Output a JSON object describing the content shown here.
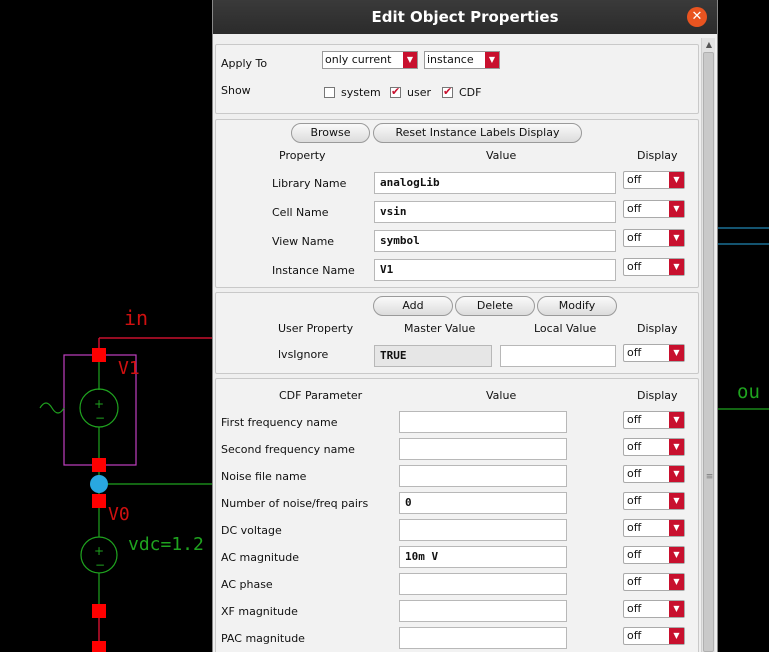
{
  "schematic": {
    "net_in": "in",
    "net_out": "ou",
    "v1_label": "V1",
    "v0_label": "V0",
    "vdc_label": "vdc=1.2"
  },
  "dialog": {
    "title": "Edit Object Properties",
    "close_glyph": "✕",
    "apply_to_label": "Apply To",
    "apply_to_value": "only current",
    "apply_to_type": "instance",
    "show_label": "Show",
    "show_options": [
      {
        "label": "system",
        "checked": false
      },
      {
        "label": "user",
        "checked": true
      },
      {
        "label": "CDF",
        "checked": true
      }
    ],
    "browse_button": "Browse",
    "reset_button": "Reset Instance Labels Display",
    "headers": {
      "property": "Property",
      "value": "Value",
      "display": "Display"
    },
    "properties": [
      {
        "label": "Library Name",
        "value": "analogLib",
        "display": "off"
      },
      {
        "label": "Cell Name",
        "value": "vsin",
        "display": "off"
      },
      {
        "label": "View Name",
        "value": "symbol",
        "display": "off"
      },
      {
        "label": "Instance Name",
        "value": "V1",
        "display": "off"
      }
    ],
    "add_button": "Add",
    "delete_button": "Delete",
    "modify_button": "Modify",
    "user_headers": {
      "user_property": "User Property",
      "master_value": "Master Value",
      "local_value": "Local Value",
      "display": "Display"
    },
    "user_properties": [
      {
        "label": "lvsIgnore",
        "master": "TRUE",
        "local": "",
        "display": "off"
      }
    ],
    "cdf_headers": {
      "param": "CDF Parameter",
      "value": "Value",
      "display": "Display"
    },
    "cdf_params": [
      {
        "label": "First frequency name",
        "value": "",
        "display": "off"
      },
      {
        "label": "Second frequency name",
        "value": "",
        "display": "off"
      },
      {
        "label": "Noise file name",
        "value": "",
        "display": "off"
      },
      {
        "label": "Number of noise/freq pairs",
        "value": "0",
        "display": "off"
      },
      {
        "label": "DC voltage",
        "value": "",
        "display": "off"
      },
      {
        "label": "AC magnitude",
        "value": "10m V",
        "display": "off"
      },
      {
        "label": "AC phase",
        "value": "",
        "display": "off"
      },
      {
        "label": "XF magnitude",
        "value": "",
        "display": "off"
      },
      {
        "label": "PAC magnitude",
        "value": "",
        "display": "off"
      }
    ],
    "dropdown_arrow": "▼",
    "scroll_up": "▲",
    "scroll_grip": "≡"
  },
  "colors": {
    "wire": "#c8102e",
    "pin": "#ff0000",
    "symbol": "#1fa31f",
    "instance_box": "#c040c0",
    "selection": "#29a8e0",
    "net_label": "#d01010",
    "out_net": "#1fa31f"
  }
}
